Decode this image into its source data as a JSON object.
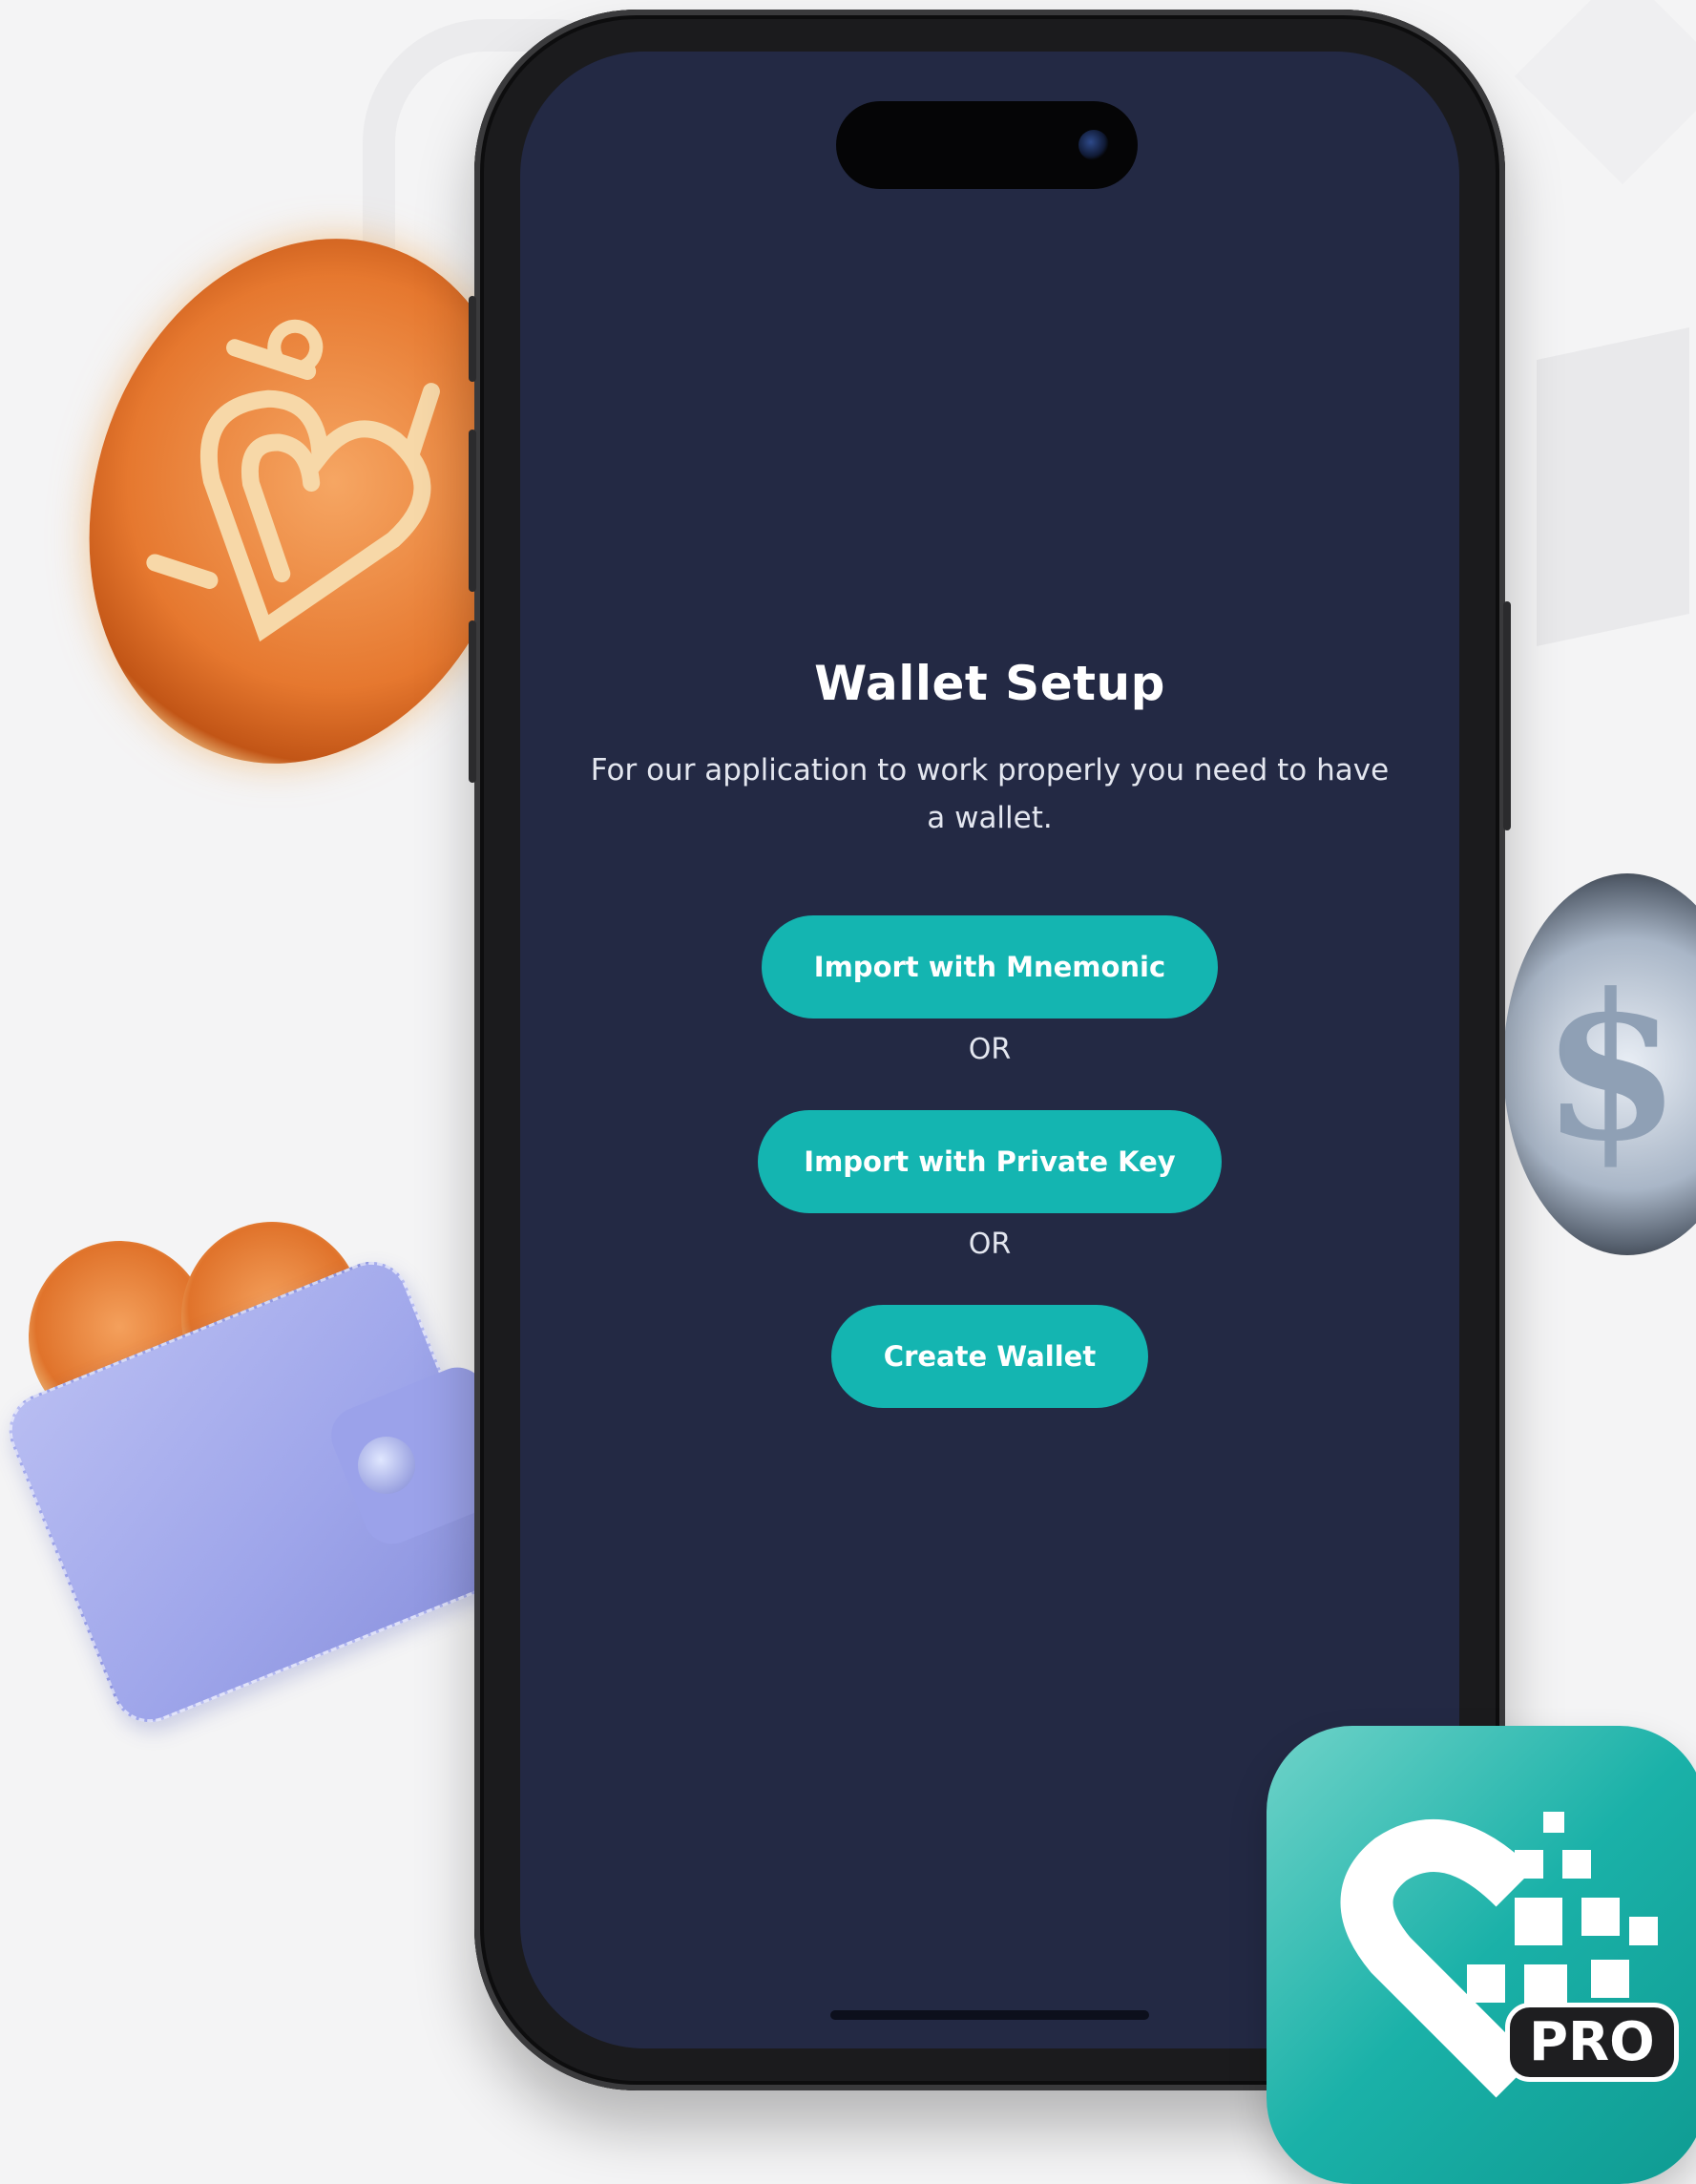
{
  "screen": {
    "title": "Wallet Setup",
    "subtitle": "For our application to work properly you need to have a wallet.",
    "buttons": {
      "mnemonic": "Import with Mnemonic",
      "private_key": "Import with Private Key",
      "create": "Create Wallet"
    },
    "separator_1": "OR",
    "separator_2": "OR"
  },
  "app_icon": {
    "badge": "PRO"
  },
  "colors": {
    "background": "#f4f4f5",
    "screen": "#232944",
    "accent": "#14b5b1",
    "text": "#ffffff"
  },
  "icons": [
    "gold-coin-icon",
    "silver-dollar-coin-icon",
    "wallet-icon",
    "app-logo-icon"
  ]
}
